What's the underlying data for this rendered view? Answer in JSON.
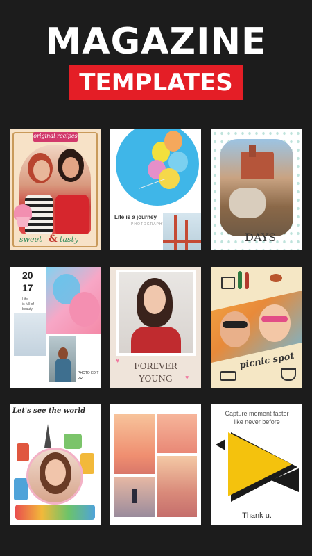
{
  "header": {
    "title": "MAGAZINE",
    "subtitle": "TEMPLATES"
  },
  "templates": [
    {
      "id": 1,
      "top_text": "original recipes",
      "bottom_left": "sweet",
      "bottom_mid": "&",
      "bottom_right": "tasty"
    },
    {
      "id": 2,
      "caption": "Life is a journey",
      "sub": "PHOTOGRAPHY"
    },
    {
      "id": 3,
      "caption": "DAYS"
    },
    {
      "id": 4,
      "year_top": "20",
      "year_bottom": "17",
      "small_line1": "Life",
      "small_line2": "is full of",
      "small_line3": "beauty",
      "brand_line1": "PHOTO EDIT",
      "brand_line2": "PRO"
    },
    {
      "id": 5,
      "line1": "FOREVER",
      "line2": "YOUNG"
    },
    {
      "id": 6,
      "caption": "picnic spot"
    },
    {
      "id": 7,
      "caption": "Let's see the world"
    },
    {
      "id": 8
    },
    {
      "id": 9,
      "line1": "Capture moment faster",
      "line2": "like never before",
      "footer": "Thank u."
    }
  ]
}
